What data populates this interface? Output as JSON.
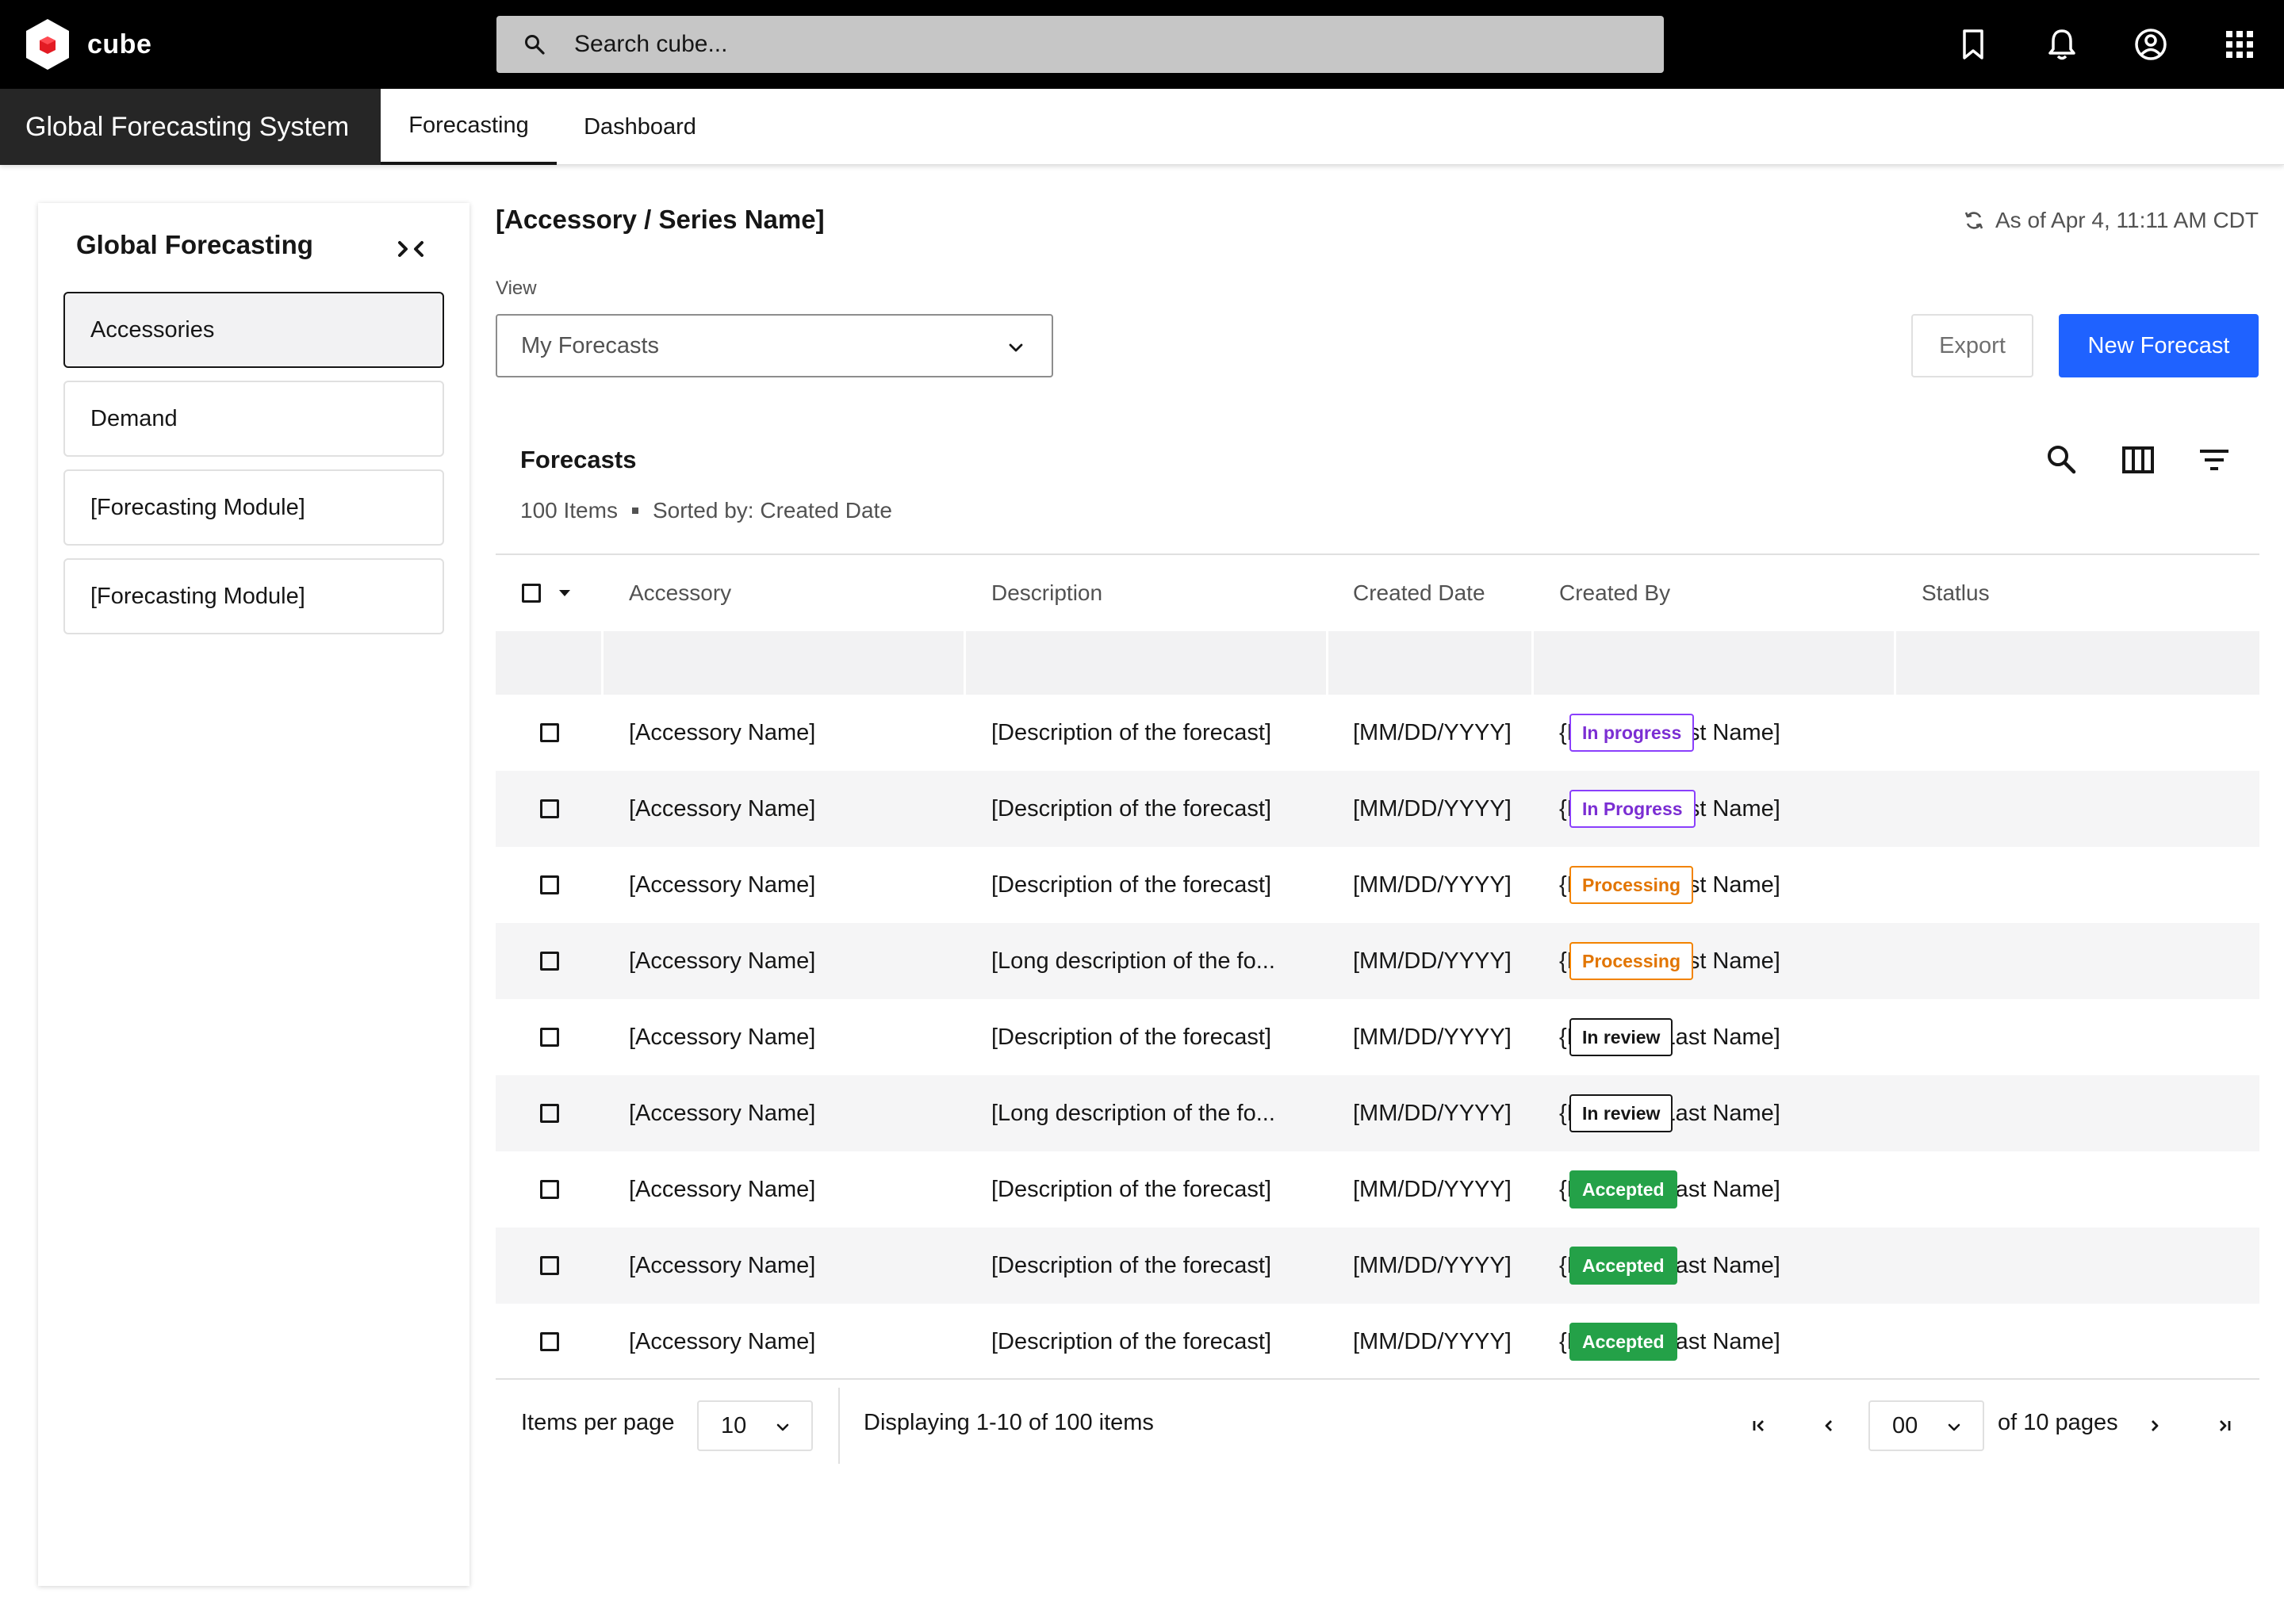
{
  "topbar": {
    "brand": "cube",
    "search_placeholder": "Search cube...",
    "icons": [
      "bookmark-icon",
      "bell-icon",
      "user-circle-icon",
      "app-grid-icon"
    ]
  },
  "nav": {
    "app_name": "Global Forecasting System",
    "tabs": [
      {
        "label": "Forecasting",
        "active": true
      },
      {
        "label": "Dashboard",
        "active": false
      }
    ]
  },
  "side": {
    "title": "Global Forecasting",
    "items": [
      {
        "label": "Accessories",
        "active": true
      },
      {
        "label": "Demand",
        "active": false
      },
      {
        "label": "[Forecasting Module]",
        "active": false
      },
      {
        "label": "[Forecasting Module]",
        "active": false
      }
    ]
  },
  "main": {
    "title": "[Accessory / Series Name]",
    "as_of": "As of Apr 4, 11:11 AM CDT",
    "view_label": "View",
    "view_value": "My Forecasts",
    "export_label": "Export",
    "new_label": "New Forecast"
  },
  "table": {
    "title": "Forecasts",
    "count": "100 Items",
    "sorted": "Sorted by: Created Date",
    "headers": [
      "Accessory",
      "Description",
      "Created Date",
      "Created By",
      "Statlus"
    ],
    "rows": [
      {
        "accessory": "[Accessory Name]",
        "description": "[Description of the forecast]",
        "date": "[MM/DD/YYYY]",
        "by": "{First and Last Name]",
        "status": "In progress",
        "tone": "purple"
      },
      {
        "accessory": "[Accessory Name]",
        "description": "[Description of the forecast]",
        "date": "[MM/DD/YYYY]",
        "by": "{First and Last Name]",
        "status": "In Progress",
        "tone": "purple"
      },
      {
        "accessory": "[Accessory Name]",
        "description": "[Description of the forecast]",
        "date": "[MM/DD/YYYY]",
        "by": "{First and Last Name]",
        "status": "Processing",
        "tone": "orange"
      },
      {
        "accessory": "[Accessory Name]",
        "description": "[Long description of the fo...",
        "date": "[MM/DD/YYYY]",
        "by": "{First and Last Name]",
        "status": "Processing",
        "tone": "orange"
      },
      {
        "accessory": "[Accessory Name]",
        "description": "[Description of the forecast]",
        "date": "[MM/DD/YYYY]",
        "by": "{First and Last Name]",
        "status": "In review",
        "tone": "black"
      },
      {
        "accessory": "[Accessory Name]",
        "description": "[Long description of the fo...",
        "date": "[MM/DD/YYYY]",
        "by": "{First and Last Name]",
        "status": "In review",
        "tone": "black"
      },
      {
        "accessory": "[Accessory Name]",
        "description": "[Description of the forecast]",
        "date": "[MM/DD/YYYY]",
        "by": "{First and Last Name]",
        "status": "Accepted",
        "tone": "green"
      },
      {
        "accessory": "[Accessory Name]",
        "description": "[Description of the forecast]",
        "date": "[MM/DD/YYYY]",
        "by": "{First and Last Name]",
        "status": "Accepted",
        "tone": "green"
      },
      {
        "accessory": "[Accessory Name]",
        "description": "[Description of the forecast]",
        "date": "[MM/DD/YYYY]",
        "by": "{First and Last Name]",
        "status": "Accepted",
        "tone": "green"
      }
    ]
  },
  "pagination": {
    "items_per_page_label": "Items per page",
    "items_per_page": "10",
    "displaying": "Displaying 1-10 of 100 items",
    "page": "00",
    "of_pages": "of 10 pages"
  },
  "colors": {
    "primary": "#1f62ff",
    "topbar": "#000000",
    "purple": "#8a3ffc",
    "orange": "#f28300",
    "green": "#24a148"
  }
}
